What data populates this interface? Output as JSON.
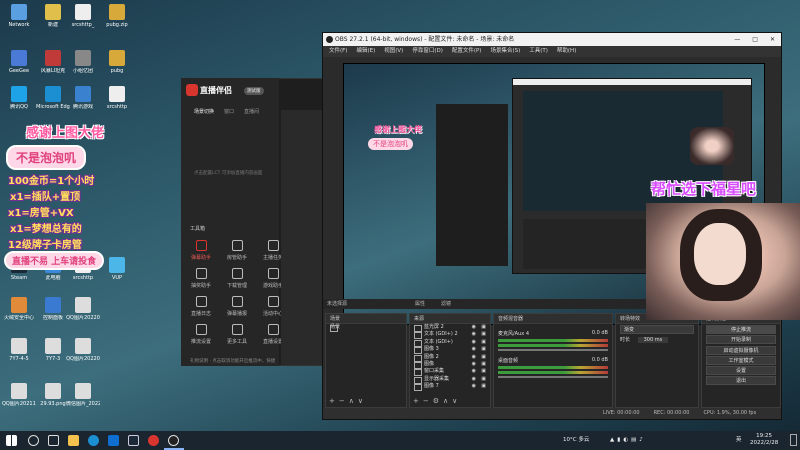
{
  "desktop_icons": [
    {
      "label": "Network",
      "color": "#5aa0e0"
    },
    {
      "label": "新建",
      "color": "#e0c04a"
    },
    {
      "label": "srcshttp_",
      "color": "#eeeeee"
    },
    {
      "label": "pubg.zip",
      "color": "#d6a93a"
    },
    {
      "label": "GeeGee",
      "color": "#4a7ad6"
    },
    {
      "label": "风暴LI坦克",
      "color": "#c03a3a"
    },
    {
      "label": "小组亿团",
      "color": "#888888"
    },
    {
      "label": "pubg",
      "color": "#d6a93a"
    },
    {
      "label": "腾讯QQ",
      "color": "#1ea3e8"
    },
    {
      "label": "Microsoft Edge",
      "color": "#1c8fd2"
    },
    {
      "label": "腾讯游戏",
      "color": "#3a82d0"
    },
    {
      "label": "srcshttp",
      "color": "#eeeeee"
    },
    {
      "label": "Steam",
      "color": "#1b2838"
    },
    {
      "label": "此电脑",
      "color": "#3b8ad9"
    },
    {
      "label": "srcshttp",
      "color": "#eeeeee"
    },
    {
      "label": "VUP",
      "color": "#4db6e8"
    },
    {
      "label": "火绒安全中心",
      "color": "#e08a3a"
    },
    {
      "label": "控制面板",
      "color": "#3a7ad0"
    },
    {
      "label": "QQ图片20220",
      "color": "#dddddd"
    },
    {
      "label": "7Y7-4-5",
      "color": "#dddddd"
    },
    {
      "label": "7Y7-3",
      "color": "#dddddd"
    },
    {
      "label": "QQ图片20220",
      "color": "#dddddd"
    },
    {
      "label": "QQ图片20211129",
      "color": "#dddddd"
    },
    {
      "label": "29.93.png",
      "color": "#dddddd"
    },
    {
      "label": "微信图片_20220",
      "color": "#dddddd"
    }
  ],
  "overlay": {
    "thanks": "感谢上图大佬",
    "name_bubble": "不是泡泡叽",
    "rules": [
      "100金币=1个小时",
      "x1=插队+置顶",
      "x1=房管+VX",
      "x1=梦想总有的",
      "12级牌子卡房管"
    ],
    "bottom_bubble": "直播不易 上车请投食",
    "cam_text": "帮忙选下福星吧"
  },
  "assistant": {
    "logo": "直播伴侣",
    "version": "测试版",
    "tabs": [
      "场景切换",
      "窗口",
      "直播间"
    ],
    "hint": "点击配置LCT 可添加直播内容画面",
    "tools_header": "工具箱",
    "tools": [
      "弹幕助手",
      "房管助手",
      "主播任务",
      "抽奖助手",
      "下载管理",
      "游戏助手",
      "直播日志",
      "弹幕播报",
      "活动中心",
      "推流设置",
      "更多工具",
      "直播设置"
    ],
    "footer": "礼物说明 · 点击取消功能开启推流中，快捷"
  },
  "obs": {
    "title": "OBS 27.2.1 (64-bit, windows) - 配置文件: 未命名 - 场景: 未命名",
    "menu": [
      "文件(F)",
      "编辑(E)",
      "视图(V)",
      "停靠窗口(D)",
      "配置文件(P)",
      "场景集合(S)",
      "工具(T)",
      "帮助(H)"
    ],
    "window_controls": [
      "—",
      "□",
      "✕"
    ],
    "source_toolbar": [
      "未选择源",
      "属性",
      "滤镜"
    ],
    "docks": {
      "scenes": {
        "title": "场景",
        "items": [
          "场景"
        ]
      },
      "sources": {
        "title": "来源",
        "items": [
          "蓝光屏 2",
          "文本 (GDI+) 2",
          "文本 (GDI+)",
          "图像 3",
          "图像 2",
          "图像",
          "窗口采集",
          "显示器采集",
          "图像 7"
        ]
      },
      "mixer": {
        "title": "音频混音器",
        "channels": [
          "麦克风/Aux 4",
          "桌面音频"
        ],
        "levels": [
          "0.0 dB",
          "0.0 dB"
        ]
      },
      "transitions": {
        "title": "转场特效",
        "type": "渐变",
        "duration_label": "时长",
        "duration": "300 ms"
      },
      "controls": {
        "title": "控制按钮",
        "buttons": [
          "停止推流",
          "开始录制",
          "启动虚拟摄像机",
          "工作室模式",
          "设置",
          "退出"
        ]
      }
    },
    "status": [
      "LIVE: 00:00:00",
      "REC: 00:00:00",
      "CPU: 1.9%, 30.00 fps"
    ]
  },
  "taskbar": {
    "weather": "10°C 多云",
    "time": "19:25",
    "date": "2022/2/28",
    "lang": "英"
  },
  "colors": {
    "obs_bg": "#2b2b2b",
    "taskbar": "#1b2530",
    "accent_red": "#d8352f"
  }
}
